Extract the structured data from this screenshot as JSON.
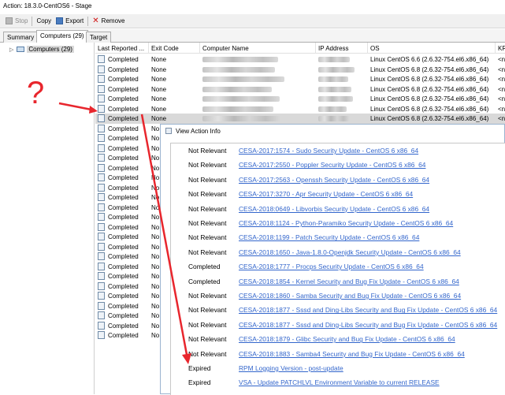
{
  "window": {
    "title": "Action: 18.3.0-CentOS6 - Stage"
  },
  "toolbar": {
    "stop_label": "Stop",
    "copy_label": "Copy",
    "export_label": "Export",
    "remove_label": "Remove"
  },
  "tabs": [
    {
      "label": "Summary"
    },
    {
      "label": "Computers (29)"
    },
    {
      "label": "Target"
    }
  ],
  "sidebar": {
    "tree_label": "Computers (29)"
  },
  "grid": {
    "columns": [
      "Last Reported ...",
      "Exit Code",
      "Computer Name",
      "IP Address",
      "OS",
      "KR"
    ],
    "rows": [
      {
        "status": "Completed",
        "exit": "None",
        "os": "Linux CentOS 6.6 (2.6.32-754.el6.x86_64)",
        "kr": "<n"
      },
      {
        "status": "Completed",
        "exit": "None",
        "os": "Linux CentOS 6.8 (2.6.32-754.el6.x86_64)",
        "kr": "<n"
      },
      {
        "status": "Completed",
        "exit": "None",
        "os": "Linux CentOS 6.8 (2.6.32-754.el6.x86_64)",
        "kr": "<n"
      },
      {
        "status": "Completed",
        "exit": "None",
        "os": "Linux CentOS 6.8 (2.6.32-754.el6.x86_64)",
        "kr": "<n"
      },
      {
        "status": "Completed",
        "exit": "None",
        "os": "Linux CentOS 6.8 (2.6.32-754.el6.x86_64)",
        "kr": "<n"
      },
      {
        "status": "Completed",
        "exit": "None",
        "os": "Linux CentOS 6.8 (2.6.32-754.el6.x86_64)",
        "kr": "<n"
      },
      {
        "status": "Completed",
        "exit": "None",
        "os": "Linux CentOS 6.8 (2.6.32-754.el6.x86_64)",
        "kr": "<n"
      },
      {
        "status": "Completed",
        "exit": "No",
        "os": "",
        "kr": ""
      },
      {
        "status": "Completed",
        "exit": "No",
        "os": "",
        "kr": ""
      },
      {
        "status": "Completed",
        "exit": "No",
        "os": "",
        "kr": ""
      },
      {
        "status": "Completed",
        "exit": "No",
        "os": "",
        "kr": ""
      },
      {
        "status": "Completed",
        "exit": "No",
        "os": "",
        "kr": ""
      },
      {
        "status": "Completed",
        "exit": "No",
        "os": "",
        "kr": ""
      },
      {
        "status": "Completed",
        "exit": "No",
        "os": "",
        "kr": ""
      },
      {
        "status": "Completed",
        "exit": "No",
        "os": "",
        "kr": ""
      },
      {
        "status": "Completed",
        "exit": "No",
        "os": "",
        "kr": ""
      },
      {
        "status": "Completed",
        "exit": "No",
        "os": "",
        "kr": ""
      },
      {
        "status": "Completed",
        "exit": "No",
        "os": "",
        "kr": ""
      },
      {
        "status": "Completed",
        "exit": "No",
        "os": "",
        "kr": ""
      },
      {
        "status": "Completed",
        "exit": "No",
        "os": "",
        "kr": ""
      },
      {
        "status": "Completed",
        "exit": "No",
        "os": "",
        "kr": ""
      },
      {
        "status": "Completed",
        "exit": "No",
        "os": "",
        "kr": ""
      },
      {
        "status": "Completed",
        "exit": "No",
        "os": "",
        "kr": ""
      },
      {
        "status": "Completed",
        "exit": "No",
        "os": "",
        "kr": ""
      },
      {
        "status": "Completed",
        "exit": "No",
        "os": "",
        "kr": ""
      },
      {
        "status": "Completed",
        "exit": "No",
        "os": "",
        "kr": ""
      },
      {
        "status": "Completed",
        "exit": "No",
        "os": "",
        "kr": ""
      },
      {
        "status": "Completed",
        "exit": "No",
        "os": "",
        "kr": ""
      },
      {
        "status": "Completed",
        "exit": "No",
        "os": "",
        "kr": ""
      }
    ]
  },
  "dialog": {
    "title": "View Action Info",
    "rows": [
      {
        "status": "Not Relevant",
        "link": "CESA-2017:1574 - Sudo Security Update - CentOS 6 x86_64"
      },
      {
        "status": "Not Relevant",
        "link": "CESA-2017:2550 - Poppler Security Update - CentOS 6 x86_64"
      },
      {
        "status": "Not Relevant",
        "link": "CESA-2017:2563 - Openssh Security Update - CentOS 6 x86_64"
      },
      {
        "status": "Not Relevant",
        "link": "CESA-2017:3270 - Apr Security Update - CentOS 6 x86_64"
      },
      {
        "status": "Not Relevant",
        "link": "CESA-2018:0649 - Libvorbis Security Update - CentOS 6 x86_64"
      },
      {
        "status": "Not Relevant",
        "link": "CESA-2018:1124 - Python-Paramiko Security Update - CentOS 6 x86_64"
      },
      {
        "status": "Not Relevant",
        "link": "CESA-2018:1199 - Patch Security Update - CentOS 6 x86_64"
      },
      {
        "status": "Not Relevant",
        "link": "CESA-2018:1650 - Java-1.8.0-Openjdk Security Update - CentOS 6 x86_64"
      },
      {
        "status": "Completed",
        "link": "CESA-2018:1777 - Procps Security Update - CentOS 6 x86_64"
      },
      {
        "status": "Completed",
        "link": "CESA-2018:1854 - Kernel Security and Bug Fix Update - CentOS 6 x86_64"
      },
      {
        "status": "Not Relevant",
        "link": "CESA-2018:1860 - Samba Security and Bug Fix Update - CentOS 6 x86_64"
      },
      {
        "status": "Not Relevant",
        "link": "CESA-2018:1877 - Sssd and Ding-Libs Security and Bug Fix Update - CentOS 6 x86_64"
      },
      {
        "status": "Not Relevant",
        "link": "CESA-2018:1877 - Sssd and Ding-Libs Security and Bug Fix Update - CentOS 6 x86_64"
      },
      {
        "status": "Not Relevant",
        "link": "CESA-2018:1879 - Glibc Security and Bug Fix Update - CentOS 6 x86_64"
      },
      {
        "status": "Not Relevant",
        "link": "CESA-2018:1883 - Samba4 Security and Bug Fix Update - CentOS 6 x86_64"
      },
      {
        "status": "Expired",
        "link": "RPM Logging Version - post-update"
      },
      {
        "status": "Expired",
        "link": "VSA - Update PATCHLVL Environment Variable to current RELEASE"
      }
    ]
  },
  "annotation": {
    "text": "?",
    "color": "#e8262d"
  }
}
